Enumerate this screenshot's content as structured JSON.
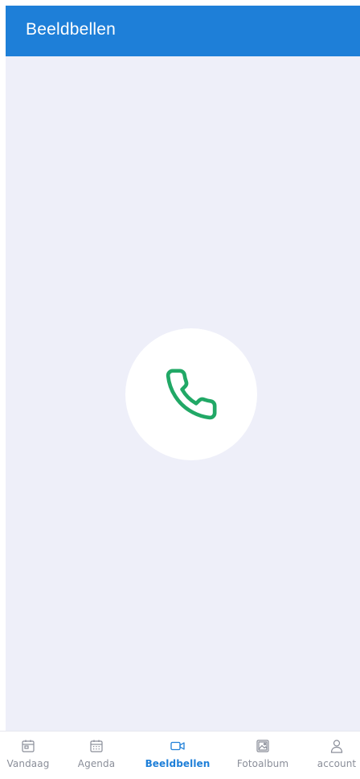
{
  "header": {
    "title": "Beeldbellen"
  },
  "call": {
    "icon": "phone-icon",
    "color": "#21a866"
  },
  "tabs": [
    {
      "label": "Vandaag",
      "icon": "today-calendar-icon",
      "active": false
    },
    {
      "label": "Agenda",
      "icon": "calendar-icon",
      "active": false
    },
    {
      "label": "Beeldbellen",
      "icon": "video-camera-icon",
      "active": true
    },
    {
      "label": "Fotoalbum",
      "icon": "photo-icon",
      "active": false
    },
    {
      "label": "account",
      "icon": "user-icon",
      "active": false
    }
  ],
  "colors": {
    "header": "#1e7fd8",
    "background": "#eeeff9",
    "active_tab": "#1e7fd8",
    "inactive_tab": "#8a8e99"
  }
}
